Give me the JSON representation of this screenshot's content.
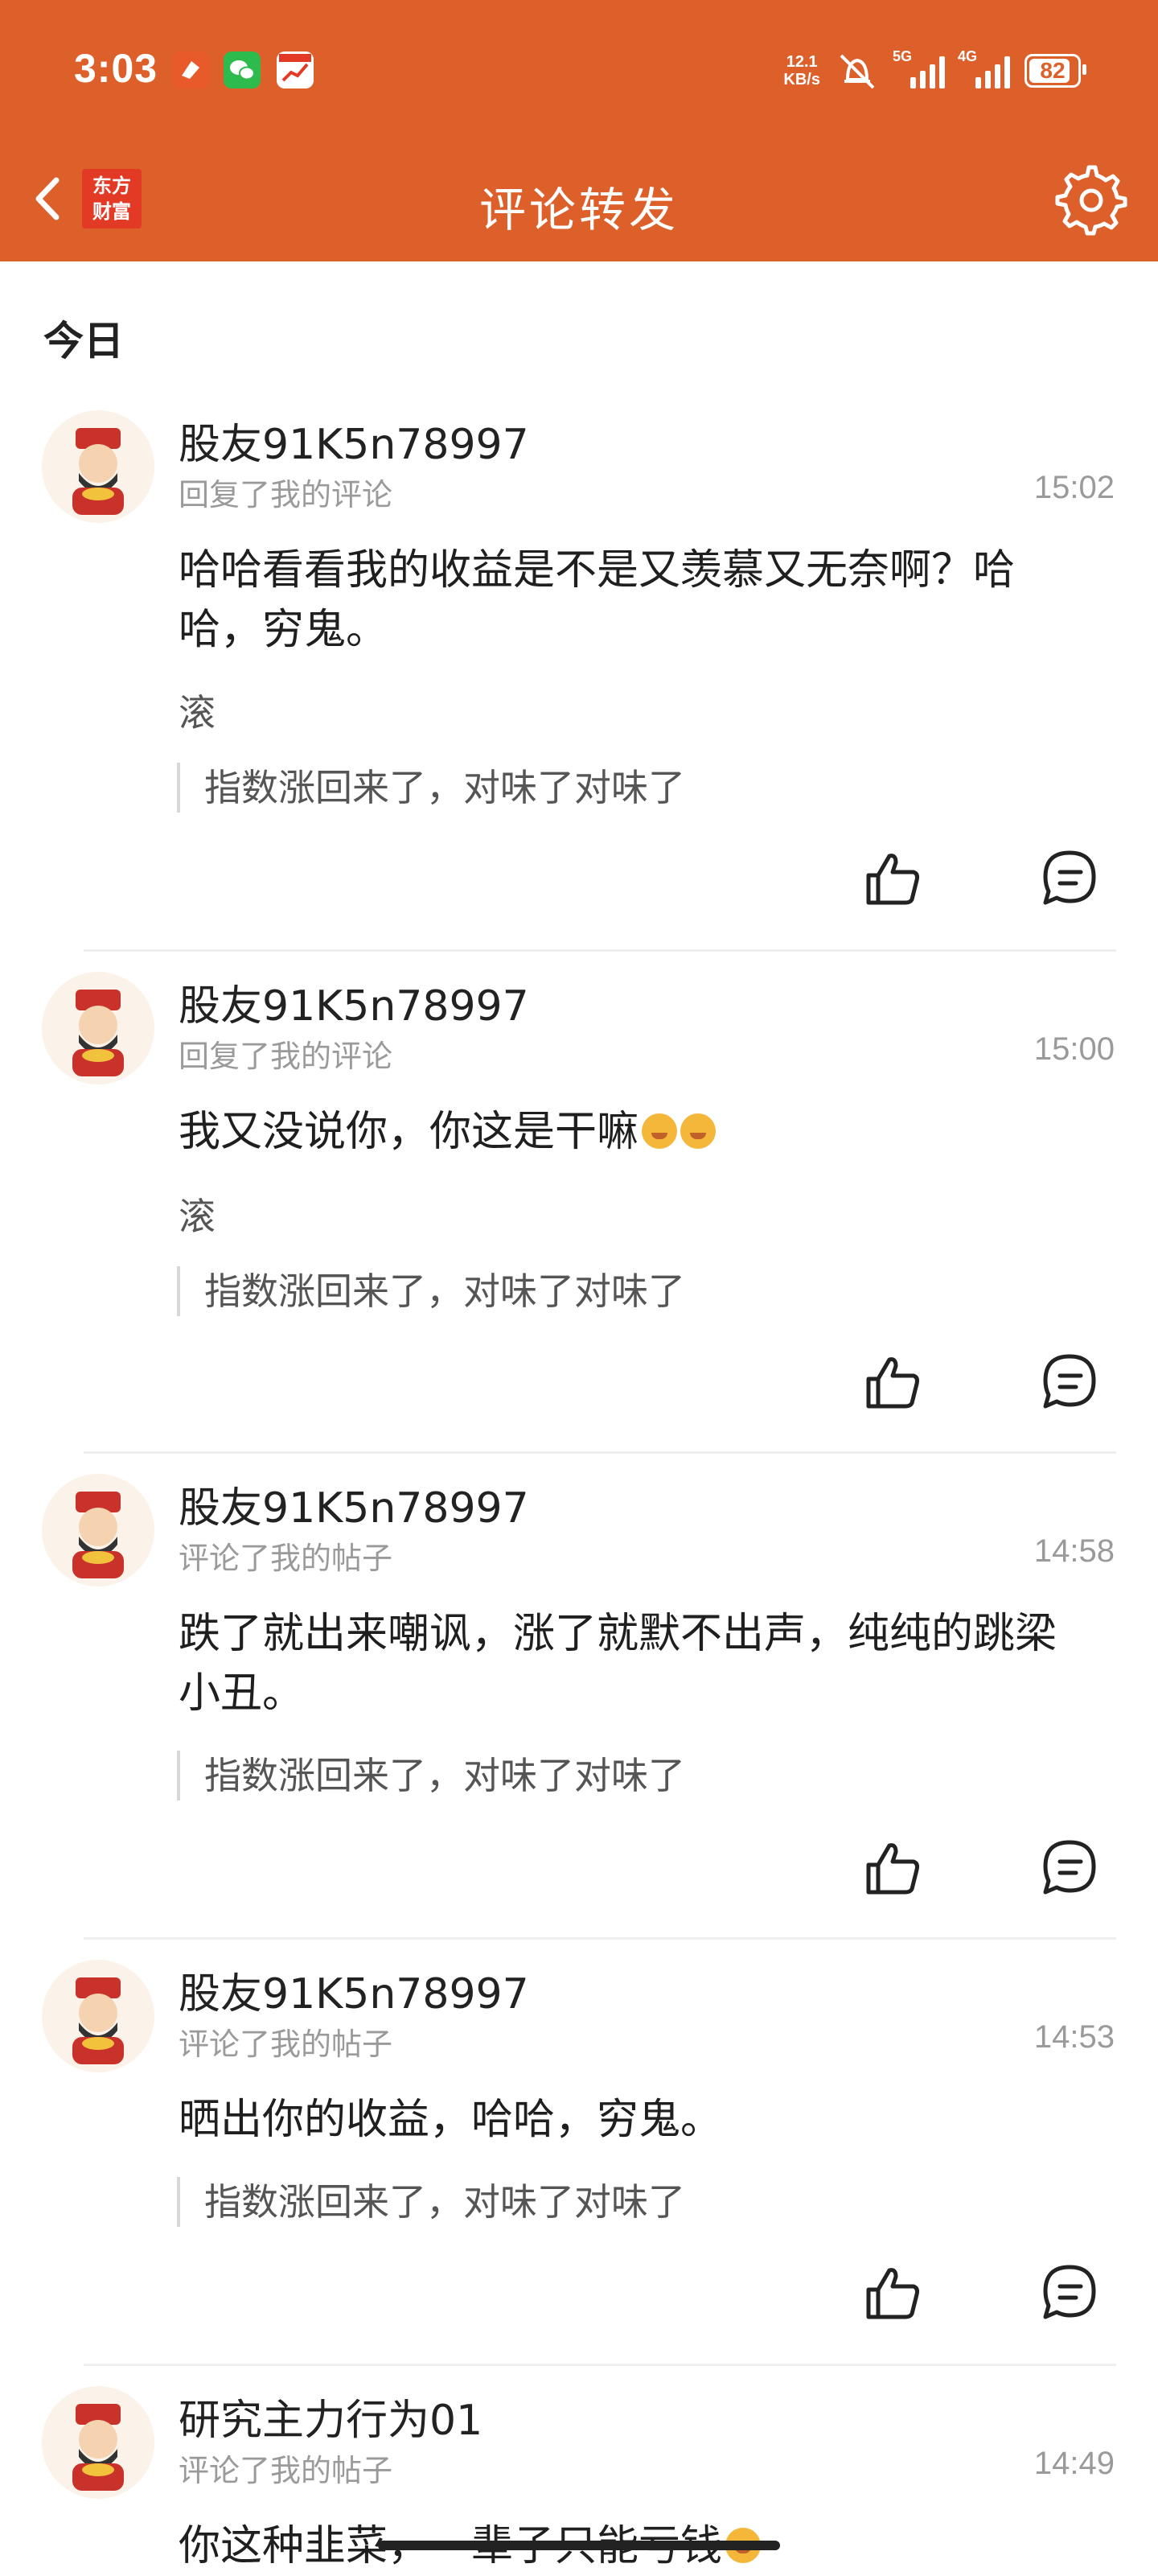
{
  "status_bar": {
    "time": "3:03",
    "net_speed_value": "12.1",
    "net_speed_unit": "KB/s",
    "signal_1": "5G",
    "signal_2": "4G",
    "battery": "82"
  },
  "nav": {
    "brand_line1": "东方",
    "brand_line2": "财富",
    "title": "评论转发"
  },
  "section_label": "今日",
  "items": [
    {
      "name": "股友91K5n78997",
      "action": "回复了我的评论",
      "time": "15:02",
      "content": "哈哈看看我的收益是不是又羡慕又无奈啊？哈哈，穷鬼。",
      "reply": "滚",
      "quote": "指数涨回来了，对味了对味了"
    },
    {
      "name": "股友91K5n78997",
      "action": "回复了我的评论",
      "time": "15:00",
      "content": "我又没说你，你这是干嘛",
      "reply": "滚",
      "quote": "指数涨回来了，对味了对味了"
    },
    {
      "name": "股友91K5n78997",
      "action": "评论了我的帖子",
      "time": "14:58",
      "content": "跌了就出来嘲讽，涨了就默不出声，纯纯的跳梁小丑。",
      "quote": "指数涨回来了，对味了对味了"
    },
    {
      "name": "股友91K5n78997",
      "action": "评论了我的帖子",
      "time": "14:53",
      "content": "晒出你的收益，哈哈，穷鬼。",
      "quote": "指数涨回来了，对味了对味了"
    },
    {
      "name": "研究主力行为01",
      "action": "评论了我的帖子",
      "time": "14:49",
      "content": "你这种韭菜，一辈子只能亏钱"
    }
  ],
  "colors": {
    "header_bg": "#dd5f2a",
    "brand_red": "#e23a25"
  }
}
